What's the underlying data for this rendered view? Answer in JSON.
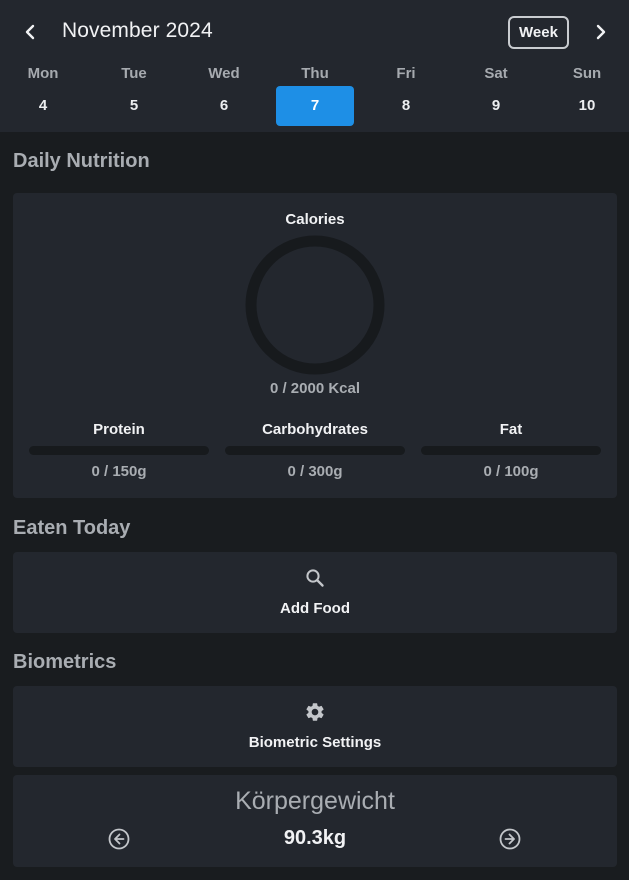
{
  "calendar": {
    "month_label": "November 2024",
    "view_mode_label": "Week",
    "days": [
      {
        "name": "Mon",
        "num": "4"
      },
      {
        "name": "Tue",
        "num": "5"
      },
      {
        "name": "Wed",
        "num": "6"
      },
      {
        "name": "Thu",
        "num": "7"
      },
      {
        "name": "Fri",
        "num": "8"
      },
      {
        "name": "Sat",
        "num": "9"
      },
      {
        "name": "Sun",
        "num": "10"
      }
    ],
    "selected_day": "7"
  },
  "nutrition": {
    "section_title": "Daily Nutrition",
    "calories_label": "Calories",
    "calories_value": "0 / 2000 Kcal",
    "calories_progress": 0,
    "macros": [
      {
        "label": "Protein",
        "value": "0 / 150g",
        "progress": 0
      },
      {
        "label": "Carbohydrates",
        "value": "0 / 300g",
        "progress": 0
      },
      {
        "label": "Fat",
        "value": "0 / 100g",
        "progress": 0
      }
    ]
  },
  "eaten": {
    "section_title": "Eaten Today",
    "add_food_label": "Add Food",
    "icon": "search-icon"
  },
  "biometrics": {
    "section_title": "Biometrics",
    "settings_label": "Biometric Settings",
    "settings_icon": "gear-icon",
    "weight_title": "Körpergewicht",
    "weight_value": "90.3kg"
  },
  "colors": {
    "accent": "#1e8fe6",
    "background": "#191c1f",
    "card": "#23272e"
  }
}
